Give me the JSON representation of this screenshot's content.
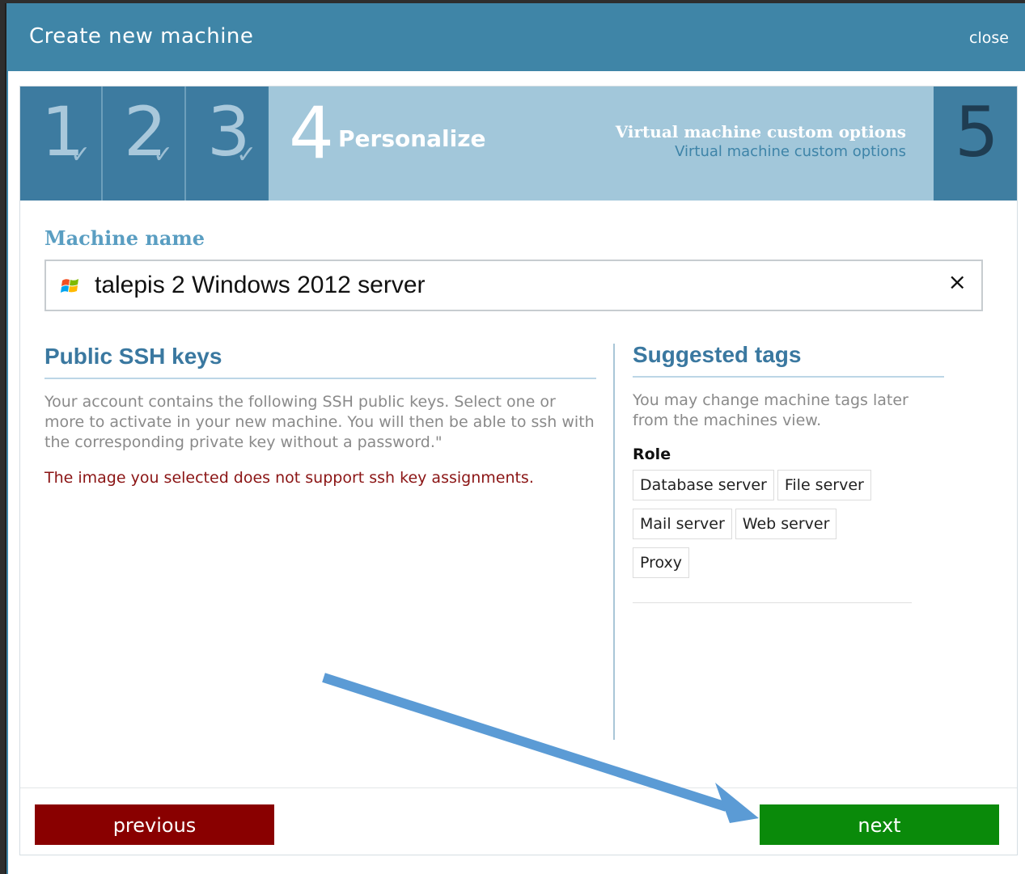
{
  "dialog": {
    "title": "Create new machine",
    "close_label": "close"
  },
  "steps": {
    "completed": [
      {
        "number": "1",
        "check": "✓"
      },
      {
        "number": "2",
        "check": "✓"
      },
      {
        "number": "3",
        "check": "✓"
      }
    ],
    "active": {
      "number": "4",
      "label": "Personalize",
      "description_title": "Virtual machine custom options",
      "description_subtitle": "Virtual machine custom options"
    },
    "next": {
      "number": "5"
    }
  },
  "machine_name": {
    "label": "Machine name",
    "value": "talepis 2 Windows 2012 server",
    "icon": "windows-logo-icon",
    "clear_glyph": "×"
  },
  "ssh_keys": {
    "title": "Public SSH keys",
    "description": "Your account contains the following SSH public keys. Select one or more to activate in your new machine. You will then be able to ssh with the corresponding private key without a password.\"",
    "warning": "The image you selected does not support ssh key assignments."
  },
  "suggested_tags": {
    "title": "Suggested tags",
    "description": "You may change machine tags later from the machines view.",
    "role_label": "Role",
    "tags": [
      "Database server",
      "File server",
      "Mail server",
      "Web server",
      "Proxy"
    ]
  },
  "buttons": {
    "previous": "previous",
    "next": "next"
  },
  "colors": {
    "header": "#3f85a7",
    "active_step": "#a2c7da",
    "previous_button": "#890000",
    "next_button": "#0a8a0a",
    "warning_text": "#8b1515",
    "annotation_arrow": "#5b9bd5"
  }
}
